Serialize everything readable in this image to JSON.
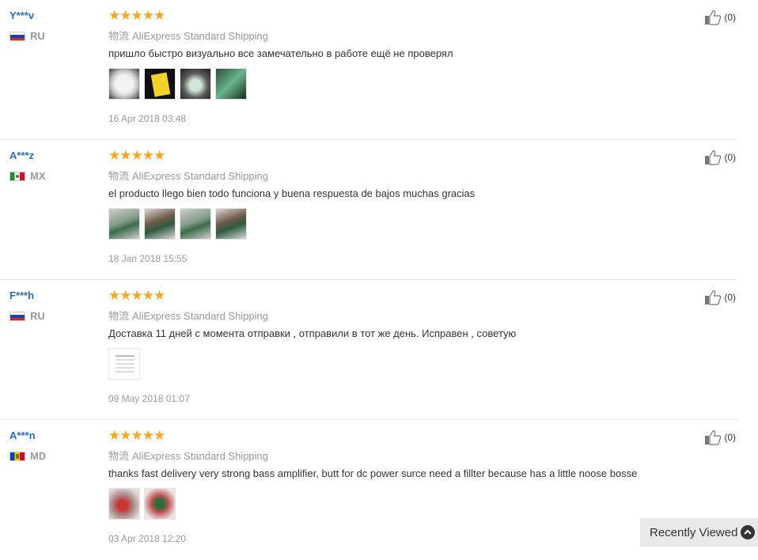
{
  "reviews": [
    {
      "user": "Y***v",
      "country": "RU",
      "stars": "★★★★★",
      "logistics": "物流",
      "shipping": "AliExpress Standard Shipping",
      "text": "пришло быстро визуально все замечательно в работе ещё не проверял",
      "date": "16 Apr 2018 03:48",
      "likes": "(0)"
    },
    {
      "user": "A***z",
      "country": "MX",
      "stars": "★★★★★",
      "logistics": "物流",
      "shipping": "AliExpress Standard Shipping",
      "text": "el producto llego bien todo funciona y buena respuesta de bajos muchas gracias",
      "date": "18 Jan 2018 15:55",
      "likes": "(0)"
    },
    {
      "user": "F***h",
      "country": "RU",
      "stars": "★★★★★",
      "logistics": "物流",
      "shipping": "AliExpress Standard Shipping",
      "text": "Доставка 11 дней с момента отправки , отправили в тот же день. Исправен , советую",
      "date": "09 May 2018 01:07",
      "likes": "(0)"
    },
    {
      "user": "A***n",
      "country": "MD",
      "stars": "★★★★★",
      "logistics": "物流",
      "shipping": "AliExpress Standard Shipping",
      "text": "thanks fast delivery very strong bass amplifier, butt for dc power surce need a fillter because has a little noose bosse",
      "date": "03 Apr 2018 12:20",
      "likes": "(0)"
    }
  ],
  "recently_viewed": {
    "label": "Recently Viewed"
  },
  "colors": {
    "username": "#2a6fb3",
    "star": "#f5a623",
    "muted": "#999999"
  }
}
